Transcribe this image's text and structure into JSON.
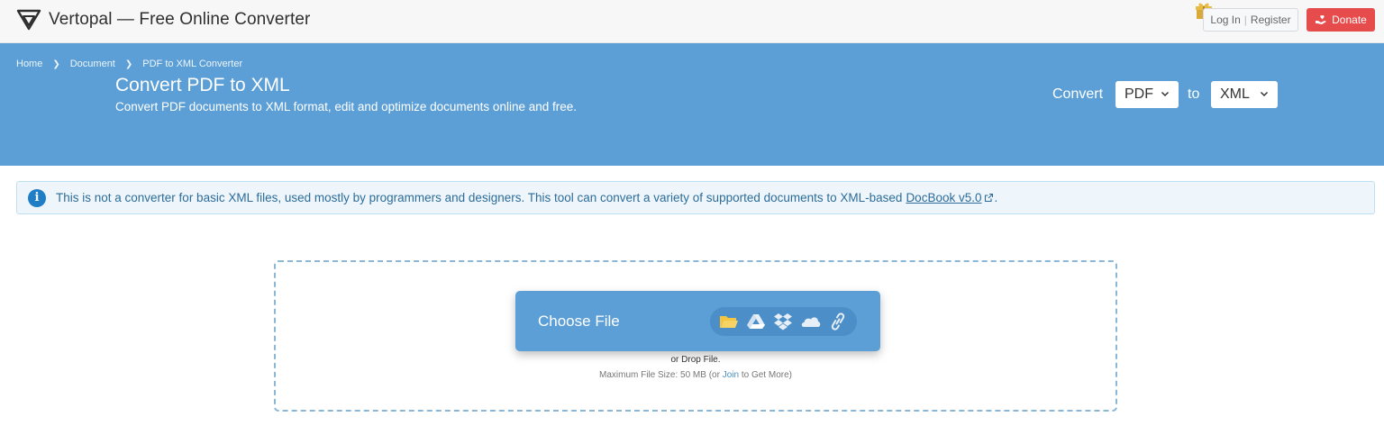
{
  "header": {
    "brand": "Vertopal — Free Online Converter",
    "login": "Log In",
    "register": "Register",
    "donate": "Donate"
  },
  "breadcrumb": [
    "Home",
    "Document",
    "PDF to XML Converter"
  ],
  "hero": {
    "title": "Convert PDF to XML",
    "subtitle": "Convert PDF documents to XML format, edit and optimize documents online and free.",
    "convert_label": "Convert",
    "to_label": "to",
    "from_format": "PDF",
    "to_format": "XML"
  },
  "notice": {
    "text": "This is not a converter for basic XML files, used mostly by programmers and designers. This tool can convert a variety of supported documents to XML-based",
    "link": "DocBook v5.0",
    "end": "."
  },
  "upload": {
    "choose_label": "Choose File",
    "sources": [
      "folder-icon",
      "google-drive-icon",
      "dropbox-icon",
      "onedrive-icon",
      "link-icon"
    ],
    "drop_text": "or Drop File.",
    "limit_prefix": "Maximum File Size: 50 MB (or",
    "limit_link": "Join",
    "limit_suffix": "to Get More)"
  },
  "colors": {
    "accent": "#5b9fd6",
    "accent_dark": "#4b8ec8",
    "donate": "#e74c4c",
    "notice_bg": "#eef6fc",
    "folder": "#f5c542"
  }
}
